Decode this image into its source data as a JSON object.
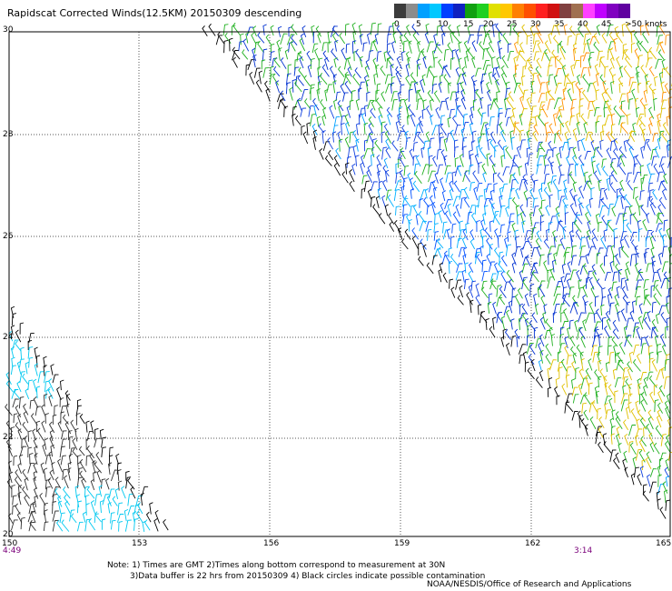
{
  "header": {
    "title": "Rapidscat Corrected Winds(12.5KM) 20150309 descending"
  },
  "legend": {
    "colors": [
      "#3c3c3c",
      "#8c8c8c",
      "#00a0ff",
      "#00c8ff",
      "#0040ff",
      "#1020c0",
      "#10a010",
      "#20d020",
      "#e0e000",
      "#ffc800",
      "#ff8000",
      "#ff5000",
      "#ff2020",
      "#d01010",
      "#804040",
      "#a07050",
      "#ff40ff",
      "#c000ff",
      "#8000c0",
      "#6000a0"
    ],
    "labels": [
      "0",
      "5",
      "10",
      "15",
      "20",
      "25",
      "30",
      "35",
      "40",
      "45",
      ">50 knots"
    ]
  },
  "map": {
    "lat_labels": [
      "30",
      "28",
      "26",
      "24",
      "22",
      "20"
    ],
    "lon_labels": [
      "150",
      "153",
      "156",
      "159",
      "162",
      "165"
    ],
    "start_time": "4:49",
    "end_time": "3:14"
  },
  "footer": {
    "note_line1": "Note: 1) Times are GMT 2)Times along bottom correspond to measurement at 30N",
    "note_line2": "3)Data buffer is 22 hrs from 20150309 4) Black circles indicate possible contamination",
    "credit": "NOAA/NESDIS/Office of Research and Applications"
  }
}
